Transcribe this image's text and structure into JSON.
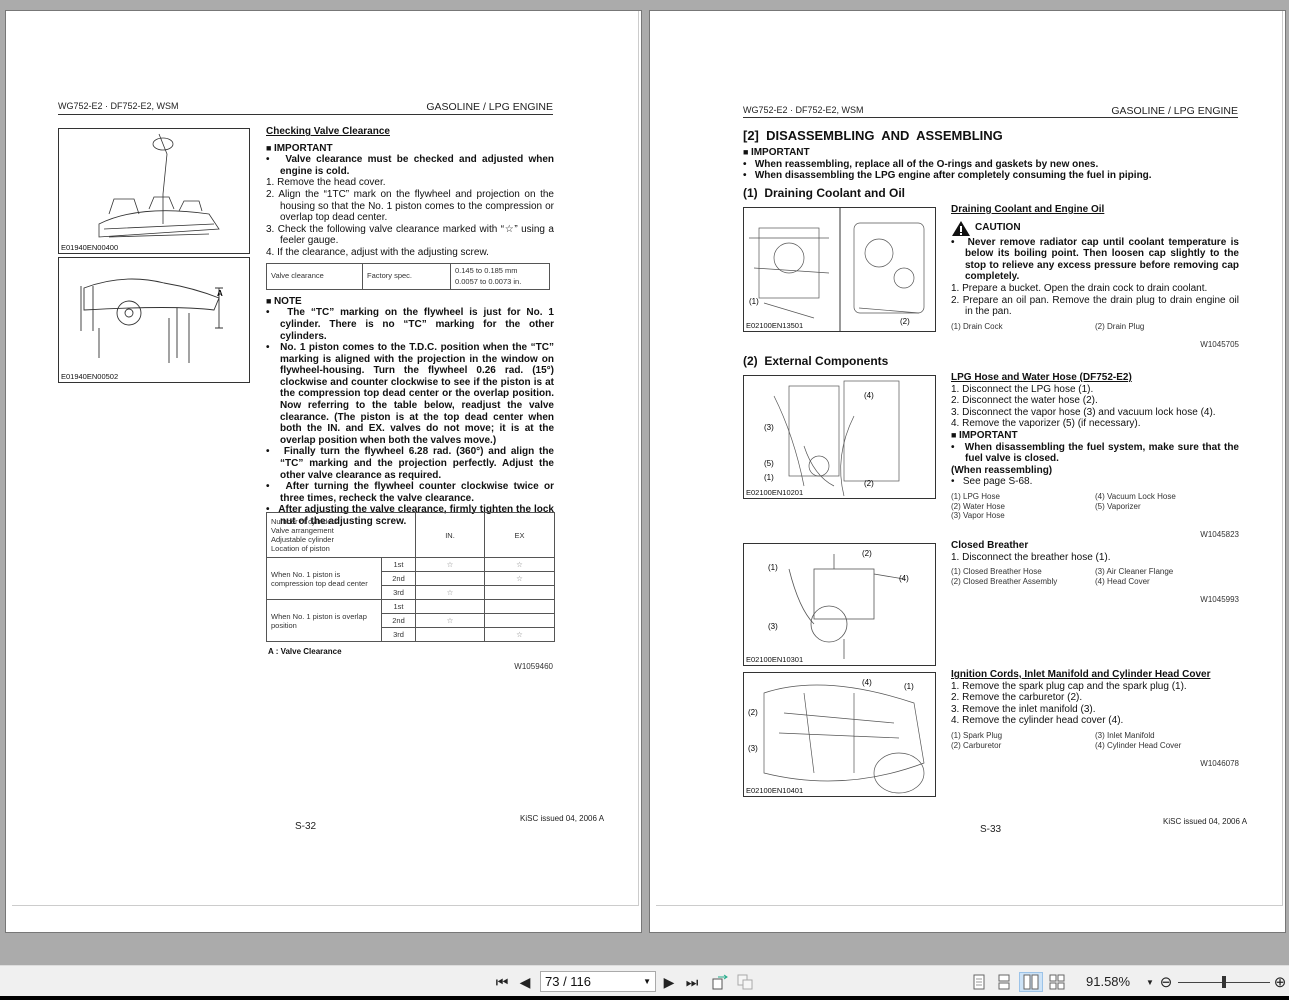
{
  "viewer": {
    "page_current": "73 / 116",
    "zoom": "91.58%",
    "zoom_slider_percent": 50,
    "active_view": "two-page"
  },
  "left_page": {
    "header_left": "WG752-E2 · DF752-E2, WSM",
    "header_right": "GASOLINE / LPG ENGINE",
    "figures": [
      "E01940EN00400",
      "E01940EN00502"
    ],
    "section_title": "Checking Valve Clearance",
    "important_label": "IMPORTANT",
    "important_bullet": "Valve clearance must be checked and adjusted when engine is cold.",
    "steps": [
      "1. Remove the head cover.",
      "2. Align the “1TC” mark on the flywheel and projection on the housing so that the No. 1 piston comes to the compression or overlap top dead center.",
      "3. Check the following valve clearance marked with “☆” using a feeler gauge.",
      "4. If the clearance, adjust with the adjusting screw."
    ],
    "spec_table": {
      "item": "Valve clearance",
      "spec": "Factory spec.",
      "value1": "0.145 to 0.185 mm",
      "value2": "0.0057 to 0.0073 in."
    },
    "note_label": "NOTE",
    "notes": [
      "The “TC” marking on the flywheel is just for No. 1 cylinder. There is no “TC” marking for the other cylinders.",
      "No. 1 piston comes to the T.D.C. position when the “TC” marking is aligned with the projection in the window on flywheel-housing.  Turn the flywheel 0.26 rad. (15°) clockwise and counter clockwise to see if the piston is at the compression top dead center or the overlap position.  Now referring to the table below, readjust the valve clearance. (The piston is at the top dead center when both the IN. and EX. valves do not move; it is at the overlap position when both the valves move.)",
      "Finally turn the flywheel 6.28 rad. (360°) and align the “TC” marking and the projection perfectly.  Adjust the other valve clearance as required.",
      "After turning the flywheel counter clockwise twice or three times, recheck the valve clearance.",
      "After adjusting the valve clearance, firmly tighten the lock nut of the adjusting screw."
    ],
    "cyl_table": {
      "header_lines": [
        "Number of cylinders",
        "Valve arrangement",
        "Adjustable cylinder",
        "Location of piston"
      ],
      "col_in": "IN.",
      "col_ex": "EX",
      "star": "☆",
      "groups": [
        {
          "label": "When No. 1 piston is compression top dead center",
          "rows": [
            {
              "cyl": "1st",
              "in": "☆",
              "ex": "☆"
            },
            {
              "cyl": "2nd",
              "in": "",
              "ex": "☆"
            },
            {
              "cyl": "3rd",
              "in": "☆",
              "ex": ""
            }
          ]
        },
        {
          "label": "When No. 1 piston is overlap position",
          "rows": [
            {
              "cyl": "1st",
              "in": "",
              "ex": ""
            },
            {
              "cyl": "2nd",
              "in": "☆",
              "ex": ""
            },
            {
              "cyl": "3rd",
              "in": "",
              "ex": "☆"
            }
          ]
        }
      ]
    },
    "fig_legend": "A : Valve Clearance",
    "code": "W1059460",
    "page_number": "S-32",
    "issued": "KiSC issued 04, 2006 A"
  },
  "right_page": {
    "header_left": "WG752-E2 · DF752-E2, WSM",
    "header_right": "GASOLINE / LPG ENGINE",
    "title": "[2]  DISASSEMBLING  AND  ASSEMBLING",
    "important_label": "IMPORTANT",
    "important_bullets": [
      "When reassembling, replace all of the O-rings and gaskets by new ones.",
      "When disassembling the LPG engine after completely consuming the fuel in piping."
    ],
    "sub1": "(1)  Draining Coolant and Oil",
    "sub2": "(2)  External Components",
    "figures": [
      "E02100EN13501",
      "E02100EN10201",
      "E02100EN10301",
      "E02100EN10401"
    ],
    "s1": {
      "title": "Draining Coolant and Engine Oil",
      "caution": "CAUTION",
      "caution_text": "Never remove radiator cap until coolant temperature is below its boiling point.  Then loosen cap slightly to the stop to relieve any excess pressure before removing cap completely.",
      "steps": [
        "1. Prepare a bucket.  Open the drain cock to drain coolant.",
        "2. Prepare an oil pan.  Remove the drain plug to drain engine oil in the pan."
      ],
      "legend": [
        "(1)  Drain Cock",
        "(2)  Drain Plug"
      ],
      "code": "W1045705"
    },
    "s2": {
      "title": "LPG Hose and Water Hose (DF752-E2)",
      "steps": [
        "1. Disconnect the LPG hose (1).",
        "2. Disconnect the water hose (2).",
        "3. Disconnect the vapor hose (3) and vacuum lock hose (4).",
        "4. Remove the vaporizer (5) (if necessary)."
      ],
      "important_label": "IMPORTANT",
      "important_text": "When disassembling the fuel system, make sure that the fuel valve is closed.",
      "when": "(When reassembling)",
      "see": "See page S-68.",
      "legend": [
        "(1)  LPG Hose",
        "(4)  Vacuum Lock Hose",
        "(2)  Water Hose",
        "(5)  Vaporizer",
        "(3)  Vapor Hose",
        ""
      ],
      "code": "W1045823"
    },
    "s3": {
      "title": "Closed Breather",
      "steps": [
        "1. Disconnect the breather hose (1)."
      ],
      "legend": [
        "(1)  Closed Breather Hose",
        "(3)  Air Cleaner Flange",
        "(2)  Closed Breather Assembly",
        "(4)  Head Cover"
      ],
      "code": "W1045993"
    },
    "s4": {
      "title": "Ignition Cords, Inlet Manifold and Cylinder Head Cover",
      "steps": [
        "1. Remove the spark plug cap and the spark plug (1).",
        "2. Remove the carburetor (2).",
        "3. Remove the inlet manifold (3).",
        "4. Remove the cylinder head cover (4)."
      ],
      "legend": [
        "(1)  Spark Plug",
        "(3)  Inlet Manifold",
        "(2)  Carburetor",
        "(4)  Cylinder Head Cover"
      ],
      "code": "W1046078"
    },
    "callouts": {
      "c1": "(1)",
      "c2": "(2)",
      "c3": "(3)",
      "c4": "(4)",
      "c5": "(5)"
    },
    "page_number": "S-33",
    "issued": "KiSC issued 04, 2006 A"
  }
}
